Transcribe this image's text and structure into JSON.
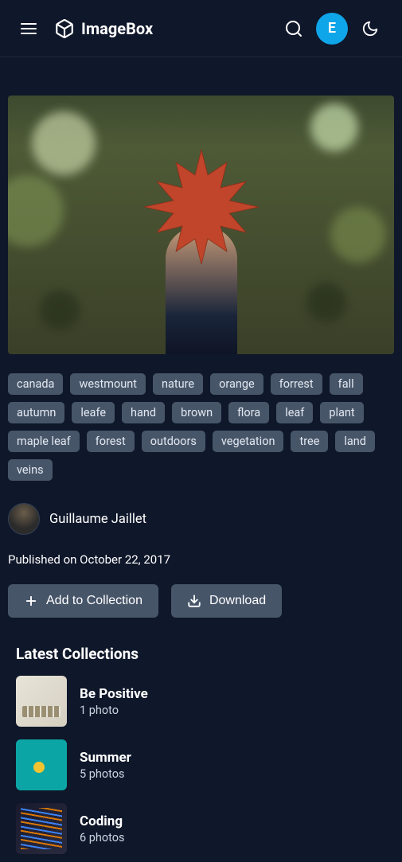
{
  "header": {
    "brand": "ImageBox",
    "avatar_initial": "E"
  },
  "tags": [
    "canada",
    "westmount",
    "nature",
    "orange",
    "forrest",
    "fall",
    "autumn",
    "leafe",
    "hand",
    "brown",
    "flora",
    "leaf",
    "plant",
    "maple leaf",
    "forest",
    "outdoors",
    "vegetation",
    "tree",
    "land",
    "veins"
  ],
  "author": {
    "name": "Guillaume Jaillet"
  },
  "published": "Published on October 22, 2017",
  "buttons": {
    "add": "Add to Collection",
    "download": "Download"
  },
  "section_title": "Latest Collections",
  "collections": [
    {
      "title": "Be Positive",
      "sub": "1 photo"
    },
    {
      "title": "Summer",
      "sub": "5 photos"
    },
    {
      "title": "Coding",
      "sub": "6 photos"
    }
  ]
}
